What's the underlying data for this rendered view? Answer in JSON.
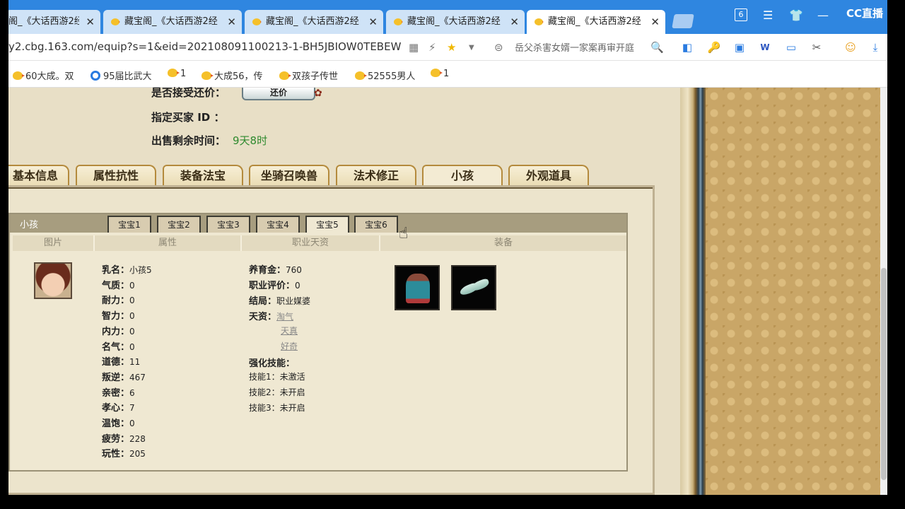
{
  "tabs": [
    {
      "title": "阁_《大话西游2经",
      "active": false
    },
    {
      "title": "藏宝阁_《大话西游2经",
      "active": false
    },
    {
      "title": "藏宝阁_《大话西游2经",
      "active": false
    },
    {
      "title": "藏宝阁_《大话西游2经",
      "active": false
    },
    {
      "title": "藏宝阁_《大话西游2经",
      "active": true
    }
  ],
  "tab_close": "✕",
  "window_controls": {
    "counter": "6",
    "brand": "CC直播"
  },
  "address": {
    "url": "y2.cbg.163.com/equip?s=1&eid=202108091100213-1-BH5JBIOW0TEBEW",
    "search_text": "岳父杀害女婿一家案再审开庭"
  },
  "bookmarks": [
    {
      "label": "60大成。双",
      "icon": "chick"
    },
    {
      "label": "95届比武大",
      "icon": "blue-circle"
    },
    {
      "label": "1",
      "icon": "chick"
    },
    {
      "label": "大成56，传",
      "icon": "chick"
    },
    {
      "label": "双孩子传世",
      "icon": "chick"
    },
    {
      "label": "52555男人",
      "icon": "chick"
    },
    {
      "label": "1",
      "icon": "chick"
    }
  ],
  "sale_info": {
    "bargain_label": "是否接受还价：",
    "bargain_button": "还价",
    "buyer_label": "指定买家 ID  ：",
    "remaining_label": "出售剩余时间：",
    "remaining_value": "9天8时"
  },
  "main_tabs": [
    "基本信息",
    "属性抗性",
    "装备法宝",
    "坐骑召唤兽",
    "法术修正",
    "小孩",
    "外观道具"
  ],
  "main_tab_active": "小孩",
  "kid_panel": {
    "title": "小孩",
    "subtabs": [
      "宝宝1",
      "宝宝2",
      "宝宝3",
      "宝宝4",
      "宝宝5",
      "宝宝6"
    ],
    "active_subtab": "宝宝5",
    "columns": [
      "图片",
      "属性",
      "职业天资",
      "装备"
    ]
  },
  "attributes": [
    {
      "label": "乳名：",
      "value": "小孩5"
    },
    {
      "label": "气质：",
      "value": "0"
    },
    {
      "label": "耐力：",
      "value": "0"
    },
    {
      "label": "智力：",
      "value": "0"
    },
    {
      "label": "内力：",
      "value": "0"
    },
    {
      "label": "名气：",
      "value": "0"
    },
    {
      "label": "道德：",
      "value": "11"
    },
    {
      "label": "叛逆：",
      "value": "467"
    },
    {
      "label": "亲密：",
      "value": "6"
    },
    {
      "label": "孝心：",
      "value": "7"
    },
    {
      "label": "温饱：",
      "value": "0"
    },
    {
      "label": "疲劳：",
      "value": "228"
    },
    {
      "label": "玩性：",
      "value": "205"
    }
  ],
  "career": {
    "upbringing_label": "养育金：",
    "upbringing_value": "760",
    "rating_label": "职业评价：",
    "rating_value": "0",
    "ending_label": "结局：",
    "ending_value": "职业媒婆",
    "talent_label": "天资：",
    "talents": [
      "淘气",
      "天真",
      "好奇"
    ],
    "skill_header": "强化技能：",
    "skills": [
      {
        "label": "技能1：",
        "value": "未激活"
      },
      {
        "label": "技能2：",
        "value": "未开启"
      },
      {
        "label": "技能3：",
        "value": "未开启"
      }
    ]
  },
  "equipment": [
    {
      "icon": "robe-icon"
    },
    {
      "icon": "shoes-icon"
    }
  ]
}
